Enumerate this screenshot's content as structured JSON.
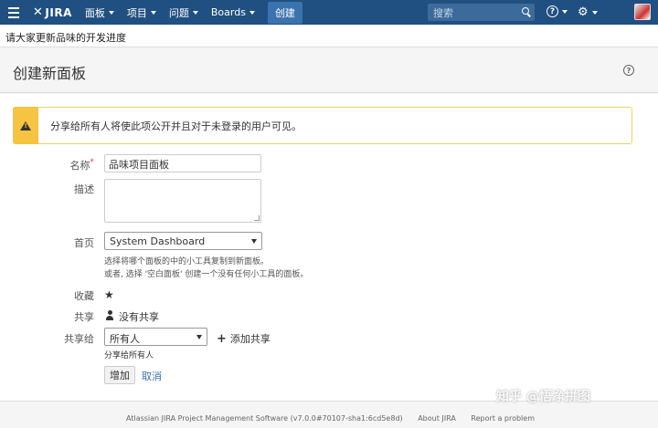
{
  "nav": {
    "logo": "JIRA",
    "items": [
      {
        "label": "面板"
      },
      {
        "label": "项目"
      },
      {
        "label": "问题"
      },
      {
        "label": "Boards"
      }
    ],
    "create_label": "创建",
    "search_placeholder": "搜索"
  },
  "announcement": "请大家更新品味的开发进度",
  "page": {
    "title": "创建新面板"
  },
  "warning": {
    "text": "分享给所有人将使此项公开并且对于未登录的用户可见。"
  },
  "form": {
    "name_label": "名称",
    "name_required_mark": "*",
    "name_value": "品味项目面板",
    "description_label": "描述",
    "home_label": "首页",
    "home_value": "System Dashboard",
    "home_help_1": "选择将哪个面板的中的小工具复制到新面板。",
    "home_help_2": "或者, 选择 '空白面板' 创建一个没有任何小工具的面板。",
    "favorite_label": "收藏",
    "share_label": "共享",
    "share_value": "没有共享",
    "share_to_label": "共享给",
    "share_to_value": "所有人",
    "add_share_label": "添加共享",
    "share_all_note": "分享给所有人",
    "submit_label": "增加",
    "cancel_label": "取消"
  },
  "footer": {
    "version": "Atlassian JIRA Project Management Software (v7.0.0#70107-sha1:6cd5e8d)",
    "about": "About JIRA",
    "report": "Report a problem"
  },
  "watermark": "知乎 @悟净拼图",
  "colors": {
    "header": "#205081",
    "create_button": "#3b73af",
    "warning": "#f6c342",
    "link": "#3b73af"
  }
}
